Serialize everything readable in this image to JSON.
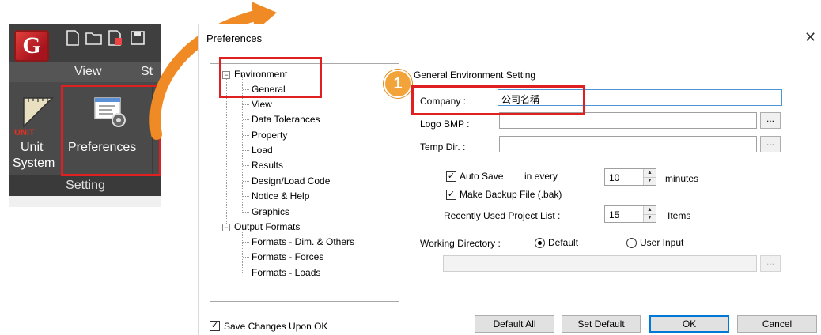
{
  "ribbon": {
    "app_logo": "G",
    "tabs": [
      "View",
      "St"
    ],
    "unit_button": {
      "line1": "Unit",
      "line2": "System"
    },
    "unit_icon_text": "UNIT",
    "preferences_label": "Preferences",
    "group_label": "Setting"
  },
  "dialog": {
    "title": "Preferences",
    "close": "✕",
    "tree": {
      "environment": "Environment",
      "environment_children": [
        "General",
        "View",
        "Data Tolerances",
        "Property",
        "Load",
        "Results",
        "Design/Load Code",
        "Notice & Help",
        "Graphics"
      ],
      "output_formats": "Output Formats",
      "output_children": [
        "Formats - Dim. & Others",
        "Formats - Forces",
        "Formats - Loads"
      ]
    },
    "section_title": "General Environment Setting",
    "badge": "1",
    "company": {
      "label": "Company :",
      "value": "公司名稱"
    },
    "logo_bmp": {
      "label": "Logo BMP :",
      "value": "",
      "browse": "..."
    },
    "temp_dir": {
      "label": "Temp Dir. :",
      "value": "",
      "browse": "..."
    },
    "auto_save": {
      "label": "Auto Save",
      "in_every": "in every",
      "value": "10",
      "unit": "minutes",
      "checked": true
    },
    "backup": {
      "label": "Make Backup File (.bak)",
      "checked": true
    },
    "recent": {
      "label": "Recently Used Project List :",
      "value": "15",
      "unit": "Items"
    },
    "working_dir": {
      "label": "Working Directory :",
      "default": "Default",
      "user_input": "User Input",
      "selected": "default",
      "path": "",
      "browse": "..."
    },
    "save_changes": {
      "label": "Save Changes Upon OK",
      "checked": true
    },
    "buttons": {
      "default_all": "Default All",
      "set_default": "Set Default",
      "ok": "OK",
      "cancel": "Cancel"
    },
    "check_mark": "✓"
  },
  "colors": {
    "highlight": "#e02020",
    "arrow": "#f08a24",
    "focus": "#0078d7"
  }
}
